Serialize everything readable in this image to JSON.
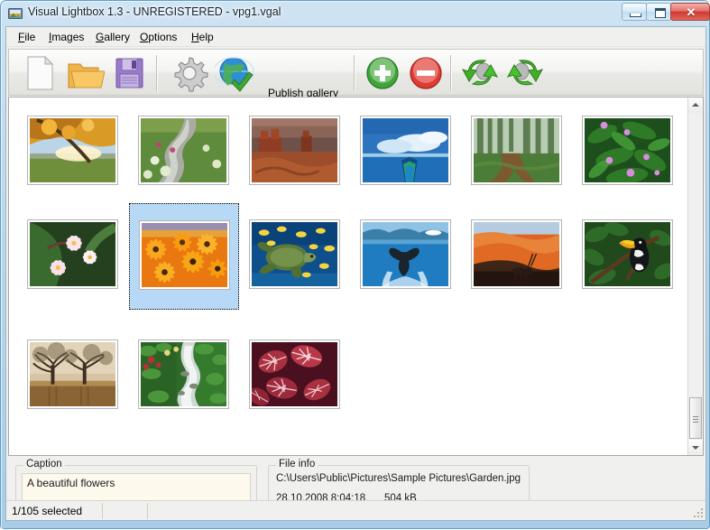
{
  "window": {
    "title": "Visual Lightbox 1.3 - UNREGISTERED - vpg1.vgal",
    "icon": "app-lightbox-icon",
    "minimize_label": "",
    "maximize_label": "",
    "close_label": "✕"
  },
  "menubar": {
    "items": [
      {
        "label": "File",
        "accel": "F"
      },
      {
        "label": "Images",
        "accel": "I"
      },
      {
        "label": "Gallery",
        "accel": "G"
      },
      {
        "label": "Options",
        "accel": "O"
      },
      {
        "label": "Help",
        "accel": "H"
      }
    ]
  },
  "toolbar": {
    "buttons": [
      {
        "name": "new-gallery-button",
        "icon": "page-icon",
        "label": ""
      },
      {
        "name": "open-gallery-button",
        "icon": "folder-open-icon",
        "label": ""
      },
      {
        "name": "save-gallery-button",
        "icon": "floppy-disk-icon",
        "label": ""
      },
      {
        "name": "options-button",
        "icon": "gear-icon",
        "label": ""
      },
      {
        "name": "publish-gallery-button",
        "icon": "globe-check-icon",
        "label": "Publish gallery"
      },
      {
        "name": "add-images-button",
        "icon": "plus-circle-icon",
        "label": ""
      },
      {
        "name": "remove-images-button",
        "icon": "minus-circle-icon",
        "label": ""
      },
      {
        "name": "rotate-left-button",
        "icon": "rotate-left-icon",
        "label": ""
      },
      {
        "name": "rotate-right-button",
        "icon": "rotate-right-icon",
        "label": ""
      }
    ],
    "publish_label": "Publish gallery"
  },
  "gallery": {
    "thumbnails": [
      {
        "index": 1,
        "name": "autumn-leaves",
        "selected": false
      },
      {
        "index": 2,
        "name": "creek",
        "selected": false
      },
      {
        "index": 3,
        "name": "desert-buttes",
        "selected": false
      },
      {
        "index": 4,
        "name": "blue-lake-canoe",
        "selected": false
      },
      {
        "index": 5,
        "name": "forest-path",
        "selected": false
      },
      {
        "index": 6,
        "name": "green-leaves",
        "selected": false
      },
      {
        "index": 7,
        "name": "frangipani",
        "selected": false
      },
      {
        "index": 8,
        "name": "orange-daisies",
        "selected": true
      },
      {
        "index": 9,
        "name": "sea-turtle",
        "selected": false
      },
      {
        "index": 10,
        "name": "whale-tail",
        "selected": false
      },
      {
        "index": 11,
        "name": "desert-oryx",
        "selected": false
      },
      {
        "index": 12,
        "name": "toucan",
        "selected": false
      },
      {
        "index": 13,
        "name": "twin-trees",
        "selected": false
      },
      {
        "index": 14,
        "name": "garden-stream",
        "selected": false
      },
      {
        "index": 15,
        "name": "red-leaves",
        "selected": false
      }
    ],
    "scrollbar": {
      "up_arrow": "▲",
      "down_arrow": "▼",
      "position_percent": 88
    }
  },
  "caption_panel": {
    "legend": "Caption",
    "value": "A beautiful flowers",
    "placeholder": ""
  },
  "fileinfo_panel": {
    "legend": "File info",
    "path": "C:\\Users\\Public\\Pictures\\Sample Pictures\\Garden.jpg",
    "date": "28.10.2008 8:04:18",
    "size": "504 kB"
  },
  "statusbar": {
    "selection": "1/105 selected",
    "panel2": "",
    "panel3": ""
  },
  "colors": {
    "selection_blue": "#b8d9f5",
    "caption_bg": "#fdf9ec",
    "chrome": "#f0f0ee",
    "close_red": "#cc3a32"
  }
}
